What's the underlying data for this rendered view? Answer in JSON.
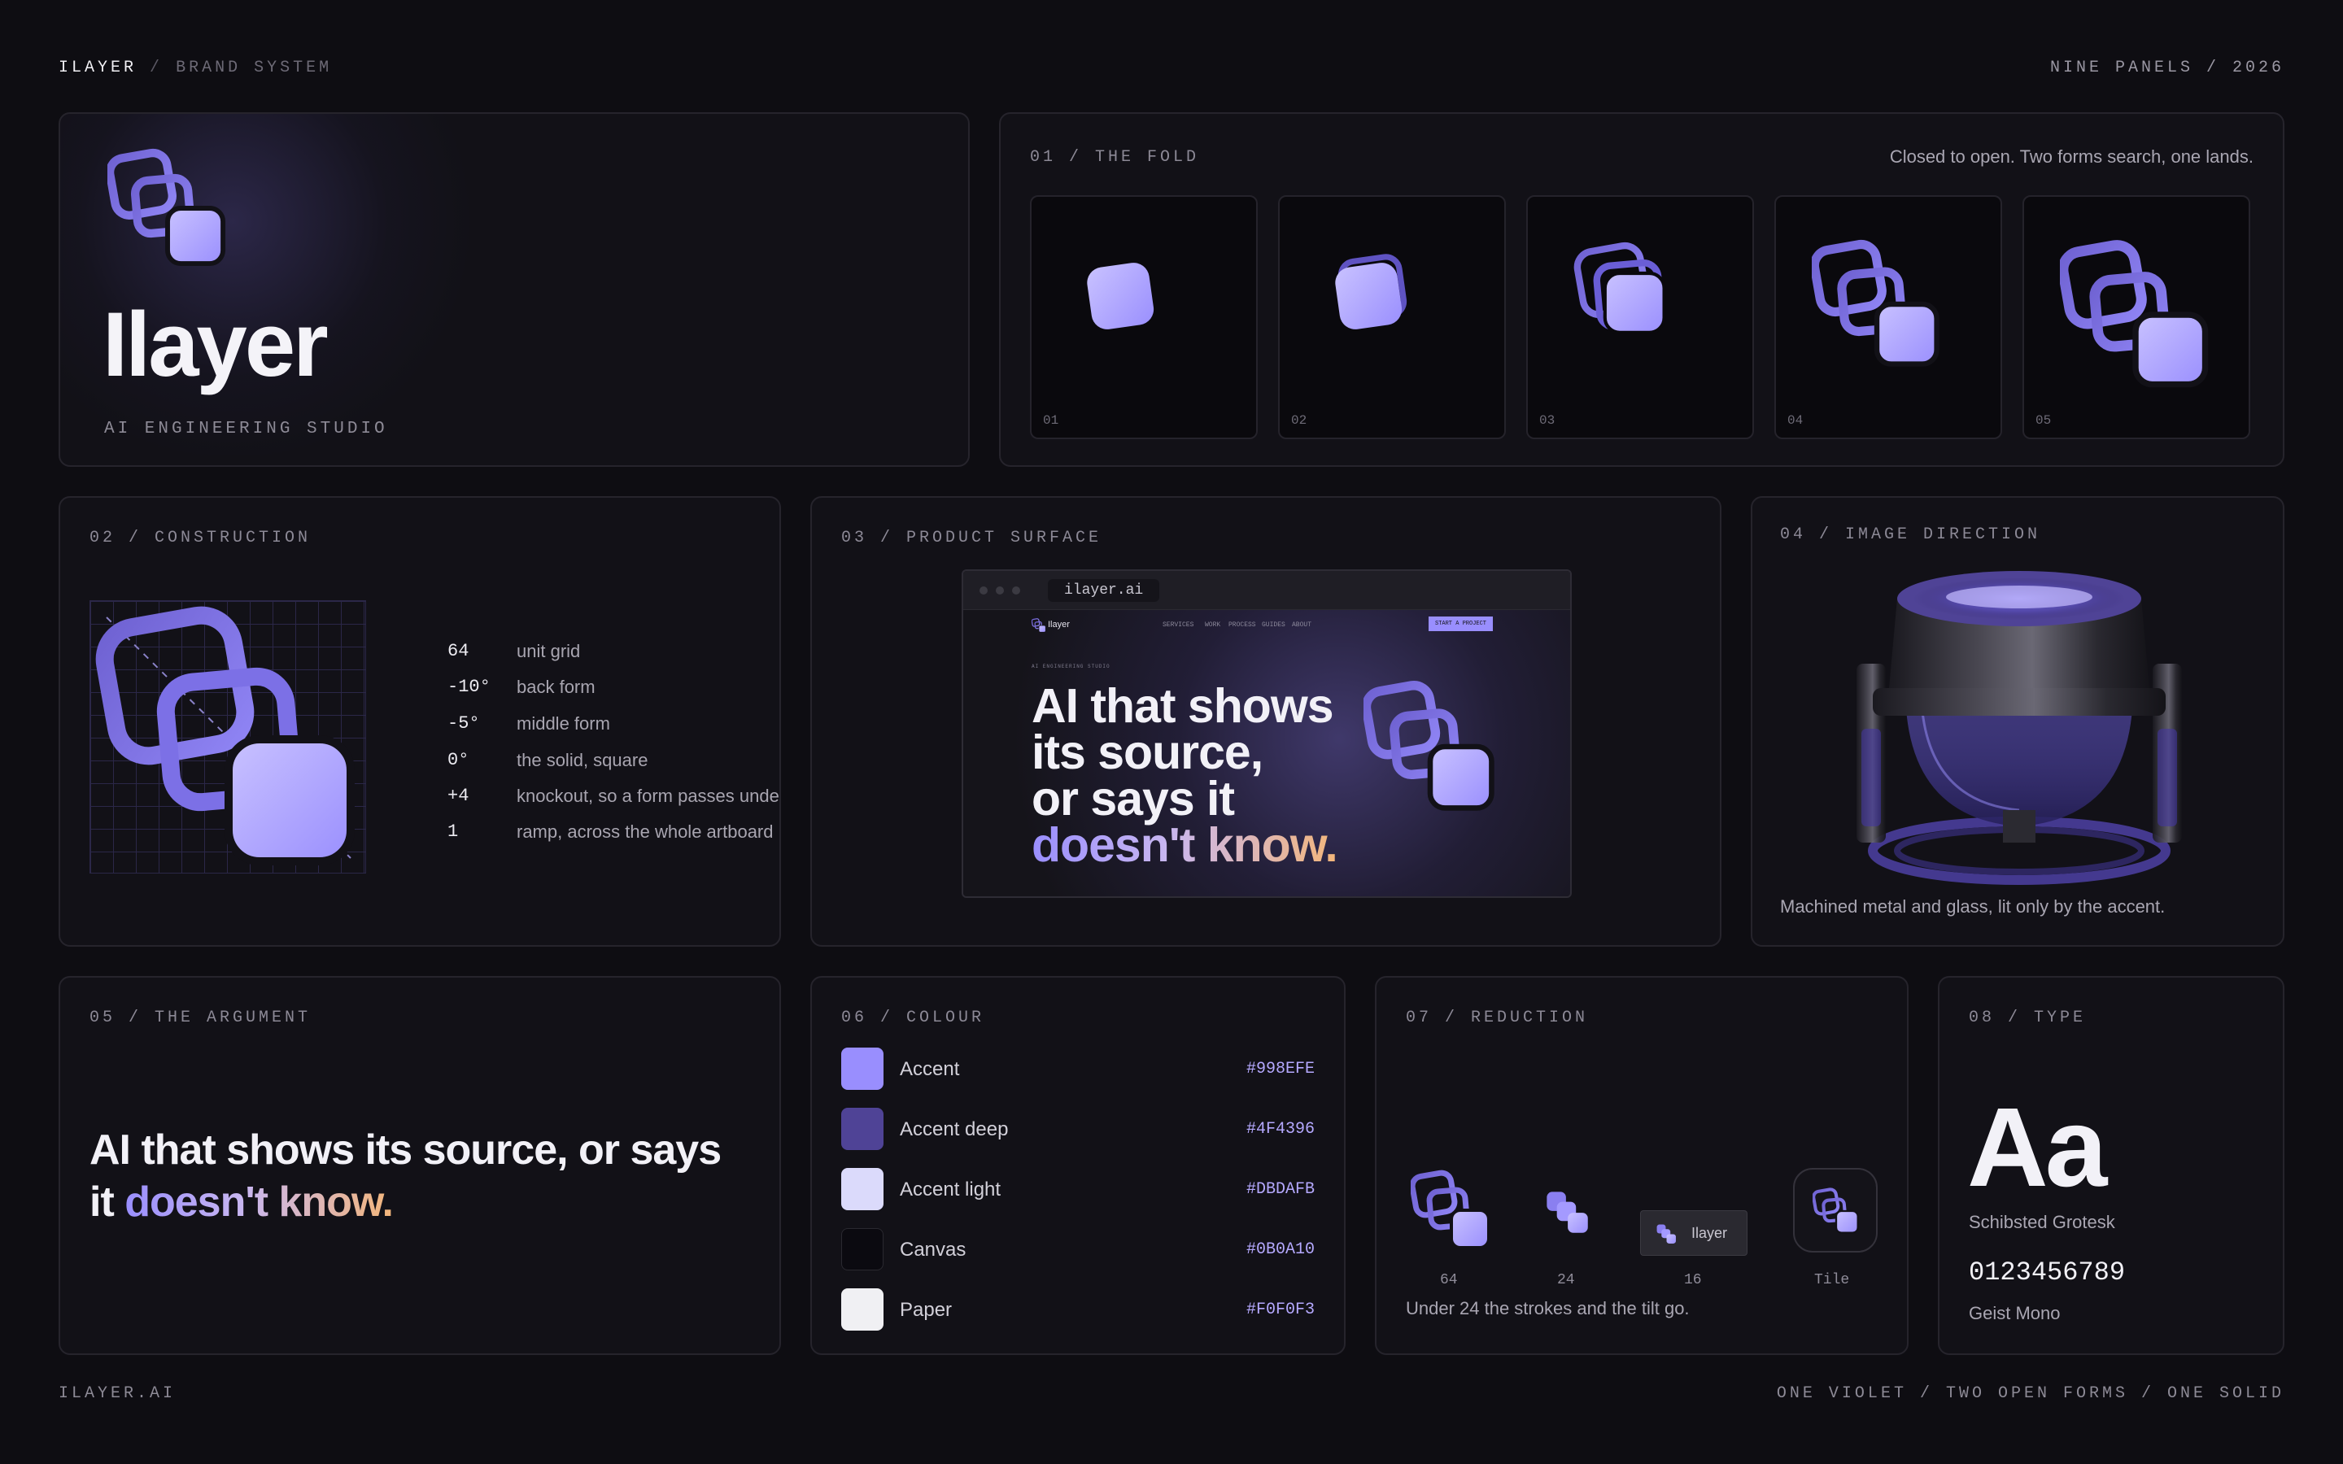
{
  "header": {
    "brand": "ILAYER",
    "separator": "/",
    "section": "BRAND SYSTEM",
    "right": "NINE PANELS / 2026"
  },
  "footer": {
    "left": "ILAYER.AI",
    "right": "ONE VIOLET / TWO OPEN FORMS / ONE SOLID"
  },
  "hero": {
    "wordmark": "Ilayer",
    "tagline": "AI ENGINEERING STUDIO"
  },
  "fold": {
    "label": "01 / THE FOLD",
    "caption": "Closed to open. Two forms search, one lands.",
    "frames": [
      "01",
      "02",
      "03",
      "04",
      "05"
    ]
  },
  "construction": {
    "label": "02 / CONSTRUCTION",
    "specs": [
      {
        "value": "64",
        "desc": "unit grid"
      },
      {
        "value": "-10°",
        "desc": "back form"
      },
      {
        "value": "-5°",
        "desc": "middle form"
      },
      {
        "value": "0°",
        "desc": "the solid, square"
      },
      {
        "value": "+4",
        "desc": "knockout, so a form passes under"
      },
      {
        "value": "1",
        "desc": "ramp, across the whole artboard"
      }
    ]
  },
  "product": {
    "label": "03 / PRODUCT SURFACE",
    "url": "ilayer.ai",
    "nav_brand": "Ilayer",
    "nav_items": [
      "SERVICES",
      "WORK",
      "PROCESS",
      "GUIDES",
      "ABOUT"
    ],
    "cta": "START A PROJECT",
    "eyebrow": "AI ENGINEERING STUDIO",
    "headline_1": "AI that shows",
    "headline_2": "its source,",
    "headline_3": "or says it",
    "headline_4": "doesn't know."
  },
  "image_direction": {
    "label": "04 / IMAGE DIRECTION",
    "caption": "Machined metal and glass, lit only by the accent."
  },
  "argument": {
    "label": "05 / THE ARGUMENT",
    "line_1": "AI that shows its source, or says",
    "line_2_prefix": "it ",
    "line_2_highlight": "doesn't know."
  },
  "colour": {
    "label": "06 / COLOUR",
    "swatches": [
      {
        "name": "Accent",
        "hex": "#998EFE"
      },
      {
        "name": "Accent deep",
        "hex": "#4F4396"
      },
      {
        "name": "Accent light",
        "hex": "#DBDAFB"
      },
      {
        "name": "Canvas",
        "hex": "#0B0A10"
      },
      {
        "name": "Paper",
        "hex": "#F0F0F3"
      }
    ]
  },
  "reduction": {
    "label": "07 / REDUCTION",
    "sizes": [
      "64",
      "24",
      "16",
      "Tile"
    ],
    "chip_label": "Ilayer",
    "caption": "Under 24 the strokes and the tilt go."
  },
  "type": {
    "label": "08 / TYPE",
    "specimen": "Aa",
    "primary_font": "Schibsted Grotesk",
    "digits": "0123456789",
    "mono_font": "Geist Mono"
  },
  "colors": {
    "accent": "#998EFE",
    "accent_deep": "#4F4396",
    "accent_light": "#DBDAFB",
    "canvas": "#0B0A10",
    "paper": "#F0F0F3"
  }
}
